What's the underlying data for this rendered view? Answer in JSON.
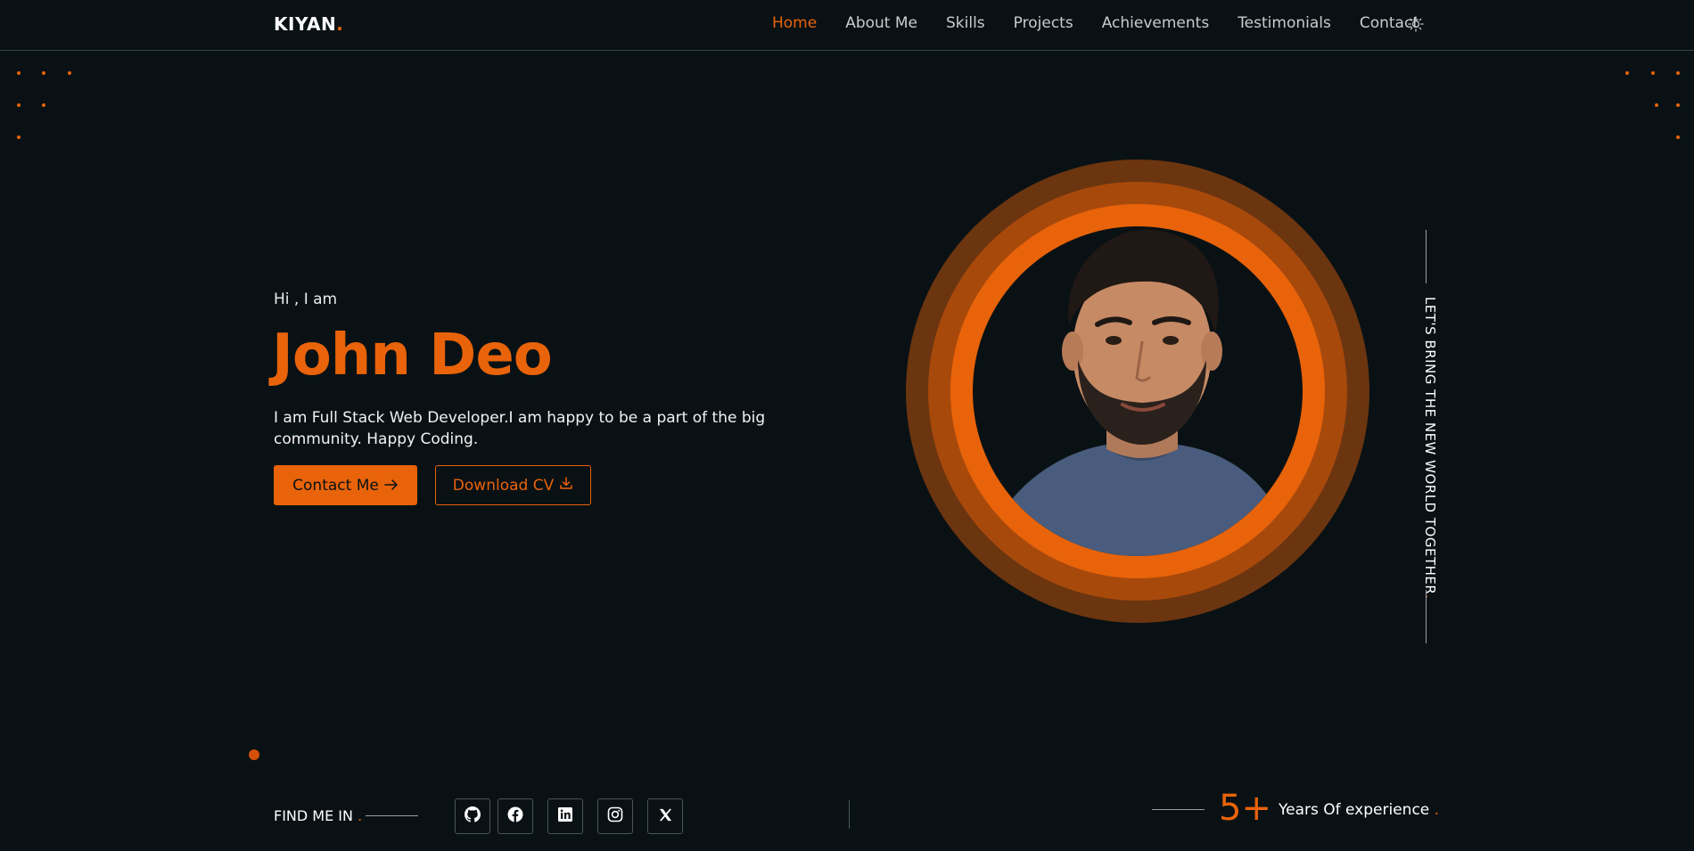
{
  "brand": {
    "name": "KIYAN",
    "dot": "."
  },
  "nav": {
    "items": [
      {
        "label": "Home",
        "active": true
      },
      {
        "label": "About Me",
        "active": false
      },
      {
        "label": "Skills",
        "active": false
      },
      {
        "label": "Projects",
        "active": false
      },
      {
        "label": "Achievements",
        "active": false
      },
      {
        "label": "Testimonials",
        "active": false
      },
      {
        "label": "Contact",
        "active": false
      }
    ],
    "theme_toggle_icon": "sun-icon"
  },
  "hero": {
    "greeting": "Hi , I am",
    "name": "John Deo",
    "description": "I am Full Stack Web Developer.I am happy to be a part of the big community. Happy Coding.",
    "primary_button": "Contact Me",
    "secondary_button": "Download CV"
  },
  "side_text": {
    "text": "LET'S BRING THE NEW WORLD TOGETHER",
    "dot": "."
  },
  "footer": {
    "find_label": "FIND ME IN",
    "find_dot": ".",
    "socials": [
      "github-icon",
      "facebook-icon",
      "linkedin-icon",
      "instagram-icon",
      "x-twitter-icon"
    ],
    "experience_number": "5+",
    "experience_label": "Years Of experience",
    "experience_dot": "."
  },
  "colors": {
    "accent": "#e8630a",
    "background": "#0a1114"
  }
}
